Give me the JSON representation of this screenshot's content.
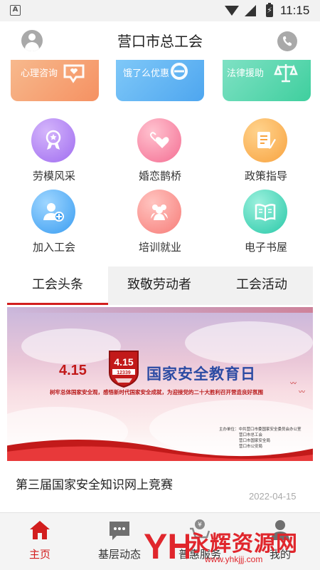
{
  "status_bar": {
    "app_icon_letter": "A",
    "time": "11:15",
    "icons": [
      "wifi-icon",
      "signal-icon",
      "battery-charging-icon"
    ]
  },
  "header": {
    "title": "营口市总工会",
    "left_icon": "user-avatar-icon",
    "right_icon": "phone-icon"
  },
  "service_cards": [
    {
      "label": "心理咨询",
      "icon": "heart-chat-icon"
    },
    {
      "label": "饿了么优惠",
      "icon": "coupon-e-icon"
    },
    {
      "label": "法律援助",
      "icon": "scales-icon"
    }
  ],
  "grid": [
    {
      "label": "劳模风采",
      "icon": "medal-icon"
    },
    {
      "label": "婚恋鹊桥",
      "icon": "hearts-icon"
    },
    {
      "label": "政策指导",
      "icon": "document-pen-icon"
    },
    {
      "label": "加入工会",
      "icon": "person-add-icon"
    },
    {
      "label": "培训就业",
      "icon": "group-icon"
    },
    {
      "label": "电子书屋",
      "icon": "book-icon"
    }
  ],
  "tabs": {
    "items": [
      "工会头条",
      "致敬劳动者",
      "工会活动"
    ],
    "active": "工会头条"
  },
  "banner": {
    "date_text": "4.15",
    "badge_text": "4.15",
    "badge_number": "12339",
    "title": "国家安全教育日",
    "slogan": "树牢总体国家安全观，感悟新时代国家安全成就，为迎接党的二十大胜利召开营造良好氛围",
    "host_label": "主办单位：",
    "hosts": [
      "中共营口市委国家安全委员会办公室",
      "营口市总工会",
      "营口市国家安全局",
      "营口市公安局"
    ]
  },
  "article": {
    "title": "第三届国家安全知识网上竞赛",
    "date": "2022-04-15"
  },
  "bottom_nav": [
    {
      "label": "主页",
      "icon": "home-icon",
      "active": true
    },
    {
      "label": "基层动态",
      "icon": "chat-bubble-icon",
      "active": false
    },
    {
      "label": "普惠服务",
      "icon": "cart-yuan-icon",
      "active": false
    },
    {
      "label": "我的",
      "icon": "profile-icon",
      "active": false
    }
  ],
  "watermark": {
    "logo_text": "YH",
    "text": "永辉资源网",
    "url": "www.yhkjjj.com"
  },
  "colors": {
    "accent_red": "#d21e1e",
    "tab_bg": "#f1f1f1",
    "nav_bg": "#f4f4f4"
  }
}
